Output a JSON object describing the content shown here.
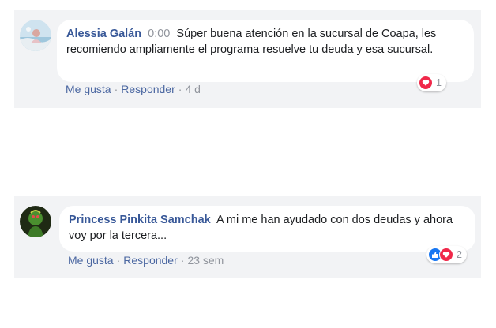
{
  "comments": [
    {
      "author": "Alessia Galán",
      "time_prefix": "0:00",
      "text": "Súper buena atención en la sucursal de Coapa, les recomiendo ampliamente el programa resuelve tu deuda y esa sucursal.",
      "actions": {
        "like": "Me gusta",
        "reply": "Responder",
        "age": "4 d"
      },
      "reactions": {
        "icons": [
          "love"
        ],
        "count": "1"
      }
    },
    {
      "author": "Princess Pinkita Samchak",
      "text": "A mi me han ayudado con dos deudas y ahora voy por la tercera...",
      "actions": {
        "like": "Me gusta",
        "reply": "Responder",
        "age": "23 sem"
      },
      "reactions": {
        "icons": [
          "like",
          "love"
        ],
        "count": "2"
      }
    }
  ],
  "colors": {
    "panel_bg": "#f2f3f5",
    "author": "#385898",
    "link": "#4b67a1",
    "muted": "#90949c",
    "love": "#f0284a",
    "like": "#1877f2"
  }
}
